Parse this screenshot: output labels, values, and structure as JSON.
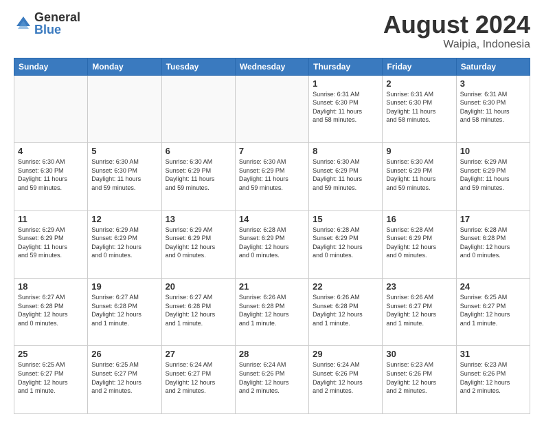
{
  "logo": {
    "general": "General",
    "blue": "Blue"
  },
  "header": {
    "month": "August 2024",
    "location": "Waipia, Indonesia"
  },
  "weekdays": [
    "Sunday",
    "Monday",
    "Tuesday",
    "Wednesday",
    "Thursday",
    "Friday",
    "Saturday"
  ],
  "weeks": [
    [
      {
        "day": "",
        "info": ""
      },
      {
        "day": "",
        "info": ""
      },
      {
        "day": "",
        "info": ""
      },
      {
        "day": "",
        "info": ""
      },
      {
        "day": "1",
        "info": "Sunrise: 6:31 AM\nSunset: 6:30 PM\nDaylight: 11 hours\nand 58 minutes."
      },
      {
        "day": "2",
        "info": "Sunrise: 6:31 AM\nSunset: 6:30 PM\nDaylight: 11 hours\nand 58 minutes."
      },
      {
        "day": "3",
        "info": "Sunrise: 6:31 AM\nSunset: 6:30 PM\nDaylight: 11 hours\nand 58 minutes."
      }
    ],
    [
      {
        "day": "4",
        "info": "Sunrise: 6:30 AM\nSunset: 6:30 PM\nDaylight: 11 hours\nand 59 minutes."
      },
      {
        "day": "5",
        "info": "Sunrise: 6:30 AM\nSunset: 6:30 PM\nDaylight: 11 hours\nand 59 minutes."
      },
      {
        "day": "6",
        "info": "Sunrise: 6:30 AM\nSunset: 6:29 PM\nDaylight: 11 hours\nand 59 minutes."
      },
      {
        "day": "7",
        "info": "Sunrise: 6:30 AM\nSunset: 6:29 PM\nDaylight: 11 hours\nand 59 minutes."
      },
      {
        "day": "8",
        "info": "Sunrise: 6:30 AM\nSunset: 6:29 PM\nDaylight: 11 hours\nand 59 minutes."
      },
      {
        "day": "9",
        "info": "Sunrise: 6:30 AM\nSunset: 6:29 PM\nDaylight: 11 hours\nand 59 minutes."
      },
      {
        "day": "10",
        "info": "Sunrise: 6:29 AM\nSunset: 6:29 PM\nDaylight: 11 hours\nand 59 minutes."
      }
    ],
    [
      {
        "day": "11",
        "info": "Sunrise: 6:29 AM\nSunset: 6:29 PM\nDaylight: 11 hours\nand 59 minutes."
      },
      {
        "day": "12",
        "info": "Sunrise: 6:29 AM\nSunset: 6:29 PM\nDaylight: 12 hours\nand 0 minutes."
      },
      {
        "day": "13",
        "info": "Sunrise: 6:29 AM\nSunset: 6:29 PM\nDaylight: 12 hours\nand 0 minutes."
      },
      {
        "day": "14",
        "info": "Sunrise: 6:28 AM\nSunset: 6:29 PM\nDaylight: 12 hours\nand 0 minutes."
      },
      {
        "day": "15",
        "info": "Sunrise: 6:28 AM\nSunset: 6:29 PM\nDaylight: 12 hours\nand 0 minutes."
      },
      {
        "day": "16",
        "info": "Sunrise: 6:28 AM\nSunset: 6:29 PM\nDaylight: 12 hours\nand 0 minutes."
      },
      {
        "day": "17",
        "info": "Sunrise: 6:28 AM\nSunset: 6:28 PM\nDaylight: 12 hours\nand 0 minutes."
      }
    ],
    [
      {
        "day": "18",
        "info": "Sunrise: 6:27 AM\nSunset: 6:28 PM\nDaylight: 12 hours\nand 0 minutes."
      },
      {
        "day": "19",
        "info": "Sunrise: 6:27 AM\nSunset: 6:28 PM\nDaylight: 12 hours\nand 1 minute."
      },
      {
        "day": "20",
        "info": "Sunrise: 6:27 AM\nSunset: 6:28 PM\nDaylight: 12 hours\nand 1 minute."
      },
      {
        "day": "21",
        "info": "Sunrise: 6:26 AM\nSunset: 6:28 PM\nDaylight: 12 hours\nand 1 minute."
      },
      {
        "day": "22",
        "info": "Sunrise: 6:26 AM\nSunset: 6:28 PM\nDaylight: 12 hours\nand 1 minute."
      },
      {
        "day": "23",
        "info": "Sunrise: 6:26 AM\nSunset: 6:27 PM\nDaylight: 12 hours\nand 1 minute."
      },
      {
        "day": "24",
        "info": "Sunrise: 6:25 AM\nSunset: 6:27 PM\nDaylight: 12 hours\nand 1 minute."
      }
    ],
    [
      {
        "day": "25",
        "info": "Sunrise: 6:25 AM\nSunset: 6:27 PM\nDaylight: 12 hours\nand 1 minute."
      },
      {
        "day": "26",
        "info": "Sunrise: 6:25 AM\nSunset: 6:27 PM\nDaylight: 12 hours\nand 2 minutes."
      },
      {
        "day": "27",
        "info": "Sunrise: 6:24 AM\nSunset: 6:27 PM\nDaylight: 12 hours\nand 2 minutes."
      },
      {
        "day": "28",
        "info": "Sunrise: 6:24 AM\nSunset: 6:26 PM\nDaylight: 12 hours\nand 2 minutes."
      },
      {
        "day": "29",
        "info": "Sunrise: 6:24 AM\nSunset: 6:26 PM\nDaylight: 12 hours\nand 2 minutes."
      },
      {
        "day": "30",
        "info": "Sunrise: 6:23 AM\nSunset: 6:26 PM\nDaylight: 12 hours\nand 2 minutes."
      },
      {
        "day": "31",
        "info": "Sunrise: 6:23 AM\nSunset: 6:26 PM\nDaylight: 12 hours\nand 2 minutes."
      }
    ]
  ]
}
